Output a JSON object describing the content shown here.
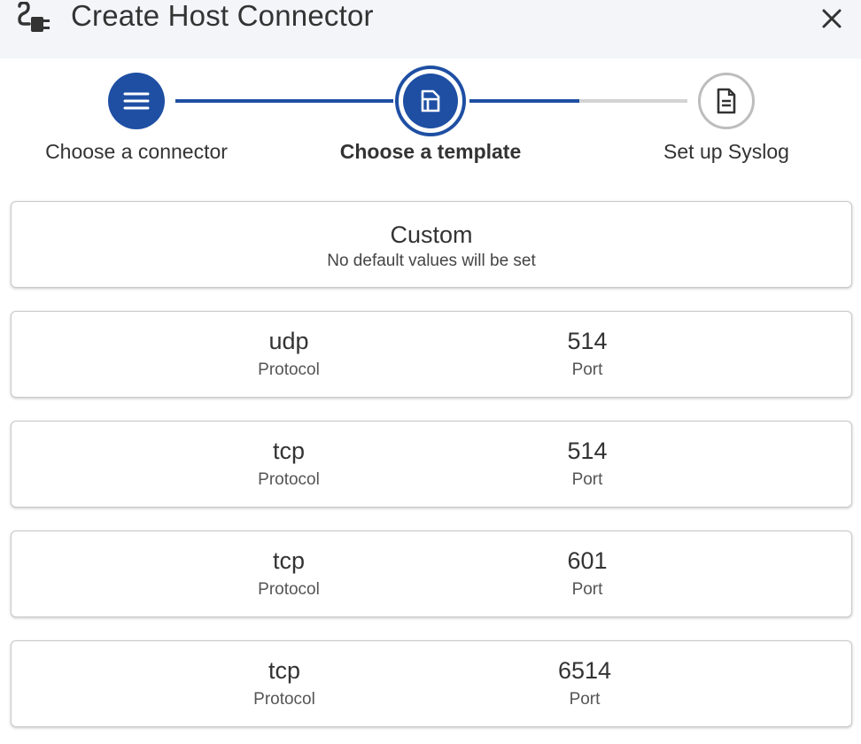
{
  "dialog": {
    "title": "Create Host Connector",
    "title_icon": "plug-icon",
    "close_icon": "close-icon"
  },
  "stepper": {
    "steps": [
      {
        "label": "Choose a connector",
        "icon": "menu-icon",
        "state": "completed"
      },
      {
        "label": "Choose a template",
        "icon": "template-icon",
        "state": "active"
      },
      {
        "label": "Set up Syslog",
        "icon": "document-icon",
        "state": "upcoming"
      }
    ],
    "colors": {
      "active": "#1e4fa3",
      "inactive": "#d3d3d3"
    }
  },
  "templates": {
    "custom": {
      "title": "Custom",
      "subtitle": "No default values will be set"
    },
    "protocol_label": "Protocol",
    "port_label": "Port",
    "items": [
      {
        "protocol": "udp",
        "port": "514"
      },
      {
        "protocol": "tcp",
        "port": "514"
      },
      {
        "protocol": "tcp",
        "port": "601"
      },
      {
        "protocol": "tcp",
        "port": "6514"
      }
    ]
  }
}
